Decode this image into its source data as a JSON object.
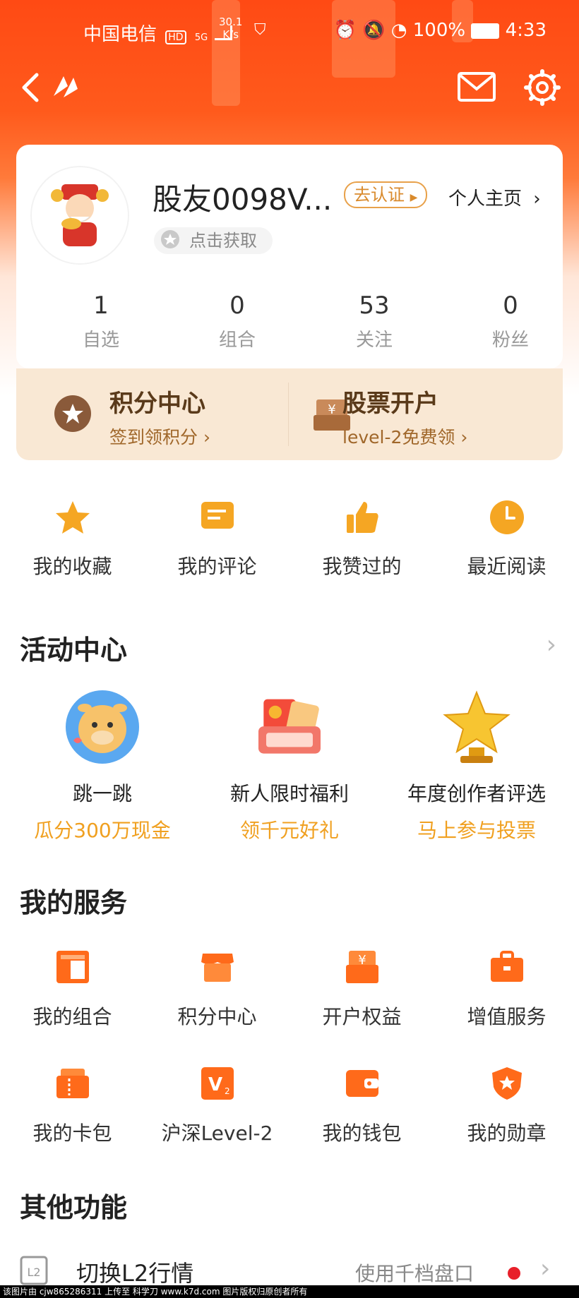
{
  "status_bar": {
    "carrier": "中国电信",
    "hd": "HD",
    "signal": "5G",
    "speed_value": "30.1",
    "speed_unit": "K/s",
    "battery": "100%",
    "time": "4:33"
  },
  "profile": {
    "username": "股友0098V...",
    "verify_label": "去认证",
    "homepage_label": "个人主页",
    "medal_label": "点击获取",
    "stats": [
      {
        "value": "1",
        "label": "自选"
      },
      {
        "value": "0",
        "label": "组合"
      },
      {
        "value": "53",
        "label": "关注"
      },
      {
        "value": "0",
        "label": "粉丝"
      }
    ]
  },
  "promo": {
    "left": {
      "title": "积分中心",
      "subtitle": "签到领积分"
    },
    "right": {
      "title": "股票开户",
      "subtitle": "level-2免费领"
    }
  },
  "quick_actions": [
    {
      "label": "我的收藏",
      "icon": "star-icon"
    },
    {
      "label": "我的评论",
      "icon": "comment-icon"
    },
    {
      "label": "我赞过的",
      "icon": "thumbs-up-icon"
    },
    {
      "label": "最近阅读",
      "icon": "clock-icon"
    }
  ],
  "activity": {
    "title": "活动中心",
    "items": [
      {
        "title": "跳一跳",
        "subtitle": "瓜分300万现金"
      },
      {
        "title": "新人限时福利",
        "subtitle": "领千元好礼"
      },
      {
        "title": "年度创作者评选",
        "subtitle": "马上参与投票"
      }
    ]
  },
  "services": {
    "title": "我的服务",
    "items": [
      {
        "label": "我的组合",
        "icon": "portfolio-icon"
      },
      {
        "label": "积分中心",
        "icon": "shop-icon"
      },
      {
        "label": "开户权益",
        "icon": "yen-box-icon"
      },
      {
        "label": "增值服务",
        "icon": "briefcase-icon"
      },
      {
        "label": "我的卡包",
        "icon": "card-icon"
      },
      {
        "label": "沪深Level-2",
        "icon": "v2-icon"
      },
      {
        "label": "我的钱包",
        "icon": "wallet-icon"
      },
      {
        "label": "我的勋章",
        "icon": "badge-icon"
      }
    ]
  },
  "other": {
    "title": "其他功能",
    "l2_label": "切换L2行情",
    "l2_value": "使用千档盘口"
  },
  "footer": "该图片由 cjw865286311 上传至 科学刀 www.k7d.com 图片版权归原创者所有",
  "colors": {
    "accent": "#ff5a1c",
    "gold": "#f0a020",
    "service_orange": "#ff6a1a"
  }
}
